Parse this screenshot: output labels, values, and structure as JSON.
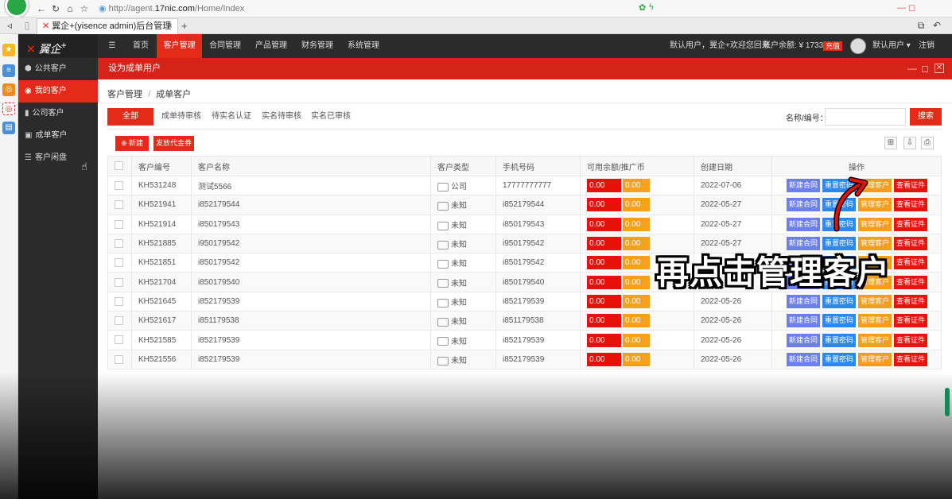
{
  "browser": {
    "url_prefix": "http://agent.",
    "url_domain": "17nic.com",
    "url_path": "/Home/Index",
    "tab_title": "翼企+(yisence admin)后台管理",
    "tab_close": "×",
    "new_tab": "+"
  },
  "app": {
    "brand": "翼企",
    "brand_plus": "+",
    "menu_icon": "☰"
  },
  "sidebar": {
    "items": [
      {
        "label": "公共客户",
        "icon": "cube-icon",
        "active": false
      },
      {
        "label": "我的客户",
        "icon": "user-icon",
        "active": true
      },
      {
        "label": "公司客户",
        "icon": "bar-chart-icon",
        "active": false
      },
      {
        "label": "成单客户",
        "icon": "list-icon",
        "active": false
      },
      {
        "label": "客户闲盘",
        "icon": "sliders-icon",
        "active": false
      }
    ]
  },
  "topnav": {
    "items": [
      "首页",
      "客户管理",
      "合同管理",
      "产品管理",
      "财务管理",
      "系统管理"
    ],
    "active_index": 1,
    "welcome": "默认用户，翼企+欢迎您回来",
    "balance": "账户余额: ¥ 1733.06",
    "recharge": "充值",
    "user": "默认用户",
    "logout": "注销"
  },
  "dialog": {
    "title": "设为成单用户"
  },
  "breadcrumb": {
    "root": "客户管理",
    "separator": "/",
    "current": "成单客户"
  },
  "filters": {
    "tabs": [
      "全部",
      "成单待审核",
      "待实名认证",
      "实名待审核",
      "实名已审核"
    ],
    "active_index": 0,
    "search_label": "名称/编号：",
    "search_placeholder": "",
    "search_button": "搜索"
  },
  "toolbar": {
    "new_label": "新建",
    "voucher_label": "发放代金券"
  },
  "table": {
    "columns": [
      "客户编号",
      "客户名称",
      "客户类型",
      "手机号码",
      "可用余额/推广币",
      "创建日期",
      "操作"
    ],
    "rows": [
      {
        "id": "KH531248",
        "name": "测试5566",
        "type": "公司",
        "phone": "17777777777",
        "balance": "0.00",
        "promo": "0.00",
        "date": "2022-07-06"
      },
      {
        "id": "KH521941",
        "name": "i852179544",
        "type": "未知",
        "phone": "i852179544",
        "balance": "0.00",
        "promo": "0.00",
        "date": "2022-05-27"
      },
      {
        "id": "KH521914",
        "name": "i850179543",
        "type": "未知",
        "phone": "i850179543",
        "balance": "0.00",
        "promo": "0.00",
        "date": "2022-05-27"
      },
      {
        "id": "KH521885",
        "name": "i950179542",
        "type": "未知",
        "phone": "i950179542",
        "balance": "0.00",
        "promo": "0.00",
        "date": "2022-05-27"
      },
      {
        "id": "KH521851",
        "name": "i850179542",
        "type": "未知",
        "phone": "i850179542",
        "balance": "0.00",
        "promo": "0.00",
        "date": ""
      },
      {
        "id": "KH521704",
        "name": "i850179540",
        "type": "未知",
        "phone": "i850179540",
        "balance": "0.00",
        "promo": "0.00",
        "date": ""
      },
      {
        "id": "KH521645",
        "name": "i852179539",
        "type": "未知",
        "phone": "i852179539",
        "balance": "0.00",
        "promo": "0.00",
        "date": "2022-05-26"
      },
      {
        "id": "KH521617",
        "name": "i851179538",
        "type": "未知",
        "phone": "i851179538",
        "balance": "0.00",
        "promo": "0.00",
        "date": "2022-05-26"
      },
      {
        "id": "KH521585",
        "name": "i852179539",
        "type": "未知",
        "phone": "i852179539",
        "balance": "0.00",
        "promo": "0.00",
        "date": "2022-05-26"
      },
      {
        "id": "KH521556",
        "name": "i852179539",
        "type": "未知",
        "phone": "i852179539",
        "balance": "0.00",
        "promo": "0.00",
        "date": "2022-05-26"
      }
    ],
    "actions": [
      "新建合同",
      "重置密码",
      "管理客户",
      "查看证件"
    ]
  },
  "overlay": {
    "caption": "再点击管理客户"
  },
  "colors": {
    "accent_red": "#e52a1a",
    "dark_bg": "#2b2b2b",
    "balance_red": "#e8110a",
    "promo_orange": "#f7a01a",
    "action_blue": "#2c88ee",
    "action_lavender": "#6d7ff0"
  }
}
